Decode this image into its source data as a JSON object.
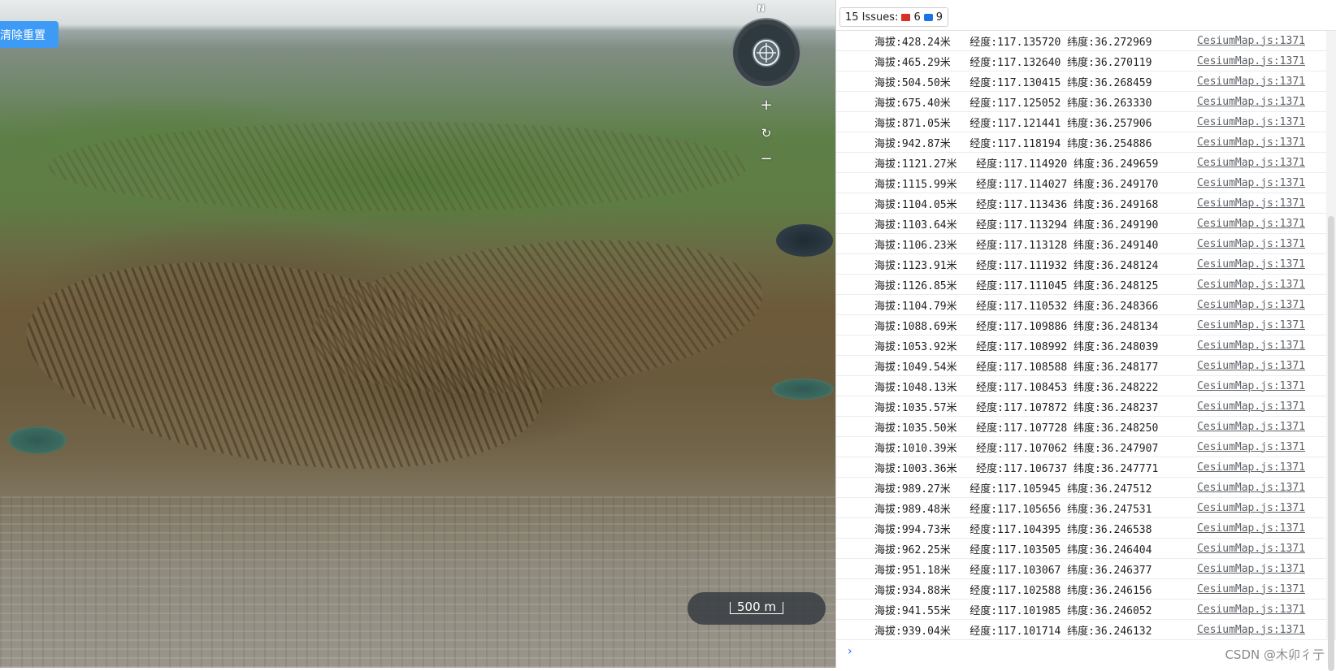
{
  "map": {
    "reset_button": "清除重置",
    "compass_north": "N",
    "zoom_in": "+",
    "reset_view": "↻",
    "zoom_out": "−",
    "scale_label": "500 m"
  },
  "devtools": {
    "issues_label": "15 Issues:",
    "errors_count": "6",
    "messages_count": "9",
    "prompt_symbol": "›",
    "logs": [
      {
        "text": "海拔:428.24米   经度:117.135720 纬度:36.272969",
        "source": "CesiumMap.js:1371"
      },
      {
        "text": "海拔:465.29米   经度:117.132640 纬度:36.270119",
        "source": "CesiumMap.js:1371"
      },
      {
        "text": "海拔:504.50米   经度:117.130415 纬度:36.268459",
        "source": "CesiumMap.js:1371"
      },
      {
        "text": "海拔:675.40米   经度:117.125052 纬度:36.263330",
        "source": "CesiumMap.js:1371"
      },
      {
        "text": "海拔:871.05米   经度:117.121441 纬度:36.257906",
        "source": "CesiumMap.js:1371"
      },
      {
        "text": "海拔:942.87米   经度:117.118194 纬度:36.254886",
        "source": "CesiumMap.js:1371"
      },
      {
        "text": "海拔:1121.27米   经度:117.114920 纬度:36.249659",
        "source": "CesiumMap.js:1371"
      },
      {
        "text": "海拔:1115.99米   经度:117.114027 纬度:36.249170",
        "source": "CesiumMap.js:1371"
      },
      {
        "text": "海拔:1104.05米   经度:117.113436 纬度:36.249168",
        "source": "CesiumMap.js:1371"
      },
      {
        "text": "海拔:1103.64米   经度:117.113294 纬度:36.249190",
        "source": "CesiumMap.js:1371"
      },
      {
        "text": "海拔:1106.23米   经度:117.113128 纬度:36.249140",
        "source": "CesiumMap.js:1371"
      },
      {
        "text": "海拔:1123.91米   经度:117.111932 纬度:36.248124",
        "source": "CesiumMap.js:1371"
      },
      {
        "text": "海拔:1126.85米   经度:117.111045 纬度:36.248125",
        "source": "CesiumMap.js:1371"
      },
      {
        "text": "海拔:1104.79米   经度:117.110532 纬度:36.248366",
        "source": "CesiumMap.js:1371"
      },
      {
        "text": "海拔:1088.69米   经度:117.109886 纬度:36.248134",
        "source": "CesiumMap.js:1371"
      },
      {
        "text": "海拔:1053.92米   经度:117.108992 纬度:36.248039",
        "source": "CesiumMap.js:1371"
      },
      {
        "text": "海拔:1049.54米   经度:117.108588 纬度:36.248177",
        "source": "CesiumMap.js:1371"
      },
      {
        "text": "海拔:1048.13米   经度:117.108453 纬度:36.248222",
        "source": "CesiumMap.js:1371"
      },
      {
        "text": "海拔:1035.57米   经度:117.107872 纬度:36.248237",
        "source": "CesiumMap.js:1371"
      },
      {
        "text": "海拔:1035.50米   经度:117.107728 纬度:36.248250",
        "source": "CesiumMap.js:1371"
      },
      {
        "text": "海拔:1010.39米   经度:117.107062 纬度:36.247907",
        "source": "CesiumMap.js:1371"
      },
      {
        "text": "海拔:1003.36米   经度:117.106737 纬度:36.247771",
        "source": "CesiumMap.js:1371"
      },
      {
        "text": "海拔:989.27米   经度:117.105945 纬度:36.247512",
        "source": "CesiumMap.js:1371"
      },
      {
        "text": "海拔:989.48米   经度:117.105656 纬度:36.247531",
        "source": "CesiumMap.js:1371"
      },
      {
        "text": "海拔:994.73米   经度:117.104395 纬度:36.246538",
        "source": "CesiumMap.js:1371"
      },
      {
        "text": "海拔:962.25米   经度:117.103505 纬度:36.246404",
        "source": "CesiumMap.js:1371"
      },
      {
        "text": "海拔:951.18米   经度:117.103067 纬度:36.246377",
        "source": "CesiumMap.js:1371"
      },
      {
        "text": "海拔:934.88米   经度:117.102588 纬度:36.246156",
        "source": "CesiumMap.js:1371"
      },
      {
        "text": "海拔:941.55米   经度:117.101985 纬度:36.246052",
        "source": "CesiumMap.js:1371"
      },
      {
        "text": "海拔:939.04米   经度:117.101714 纬度:36.246132",
        "source": "CesiumMap.js:1371"
      }
    ]
  },
  "watermark": "CSDN @木卯彳亍"
}
